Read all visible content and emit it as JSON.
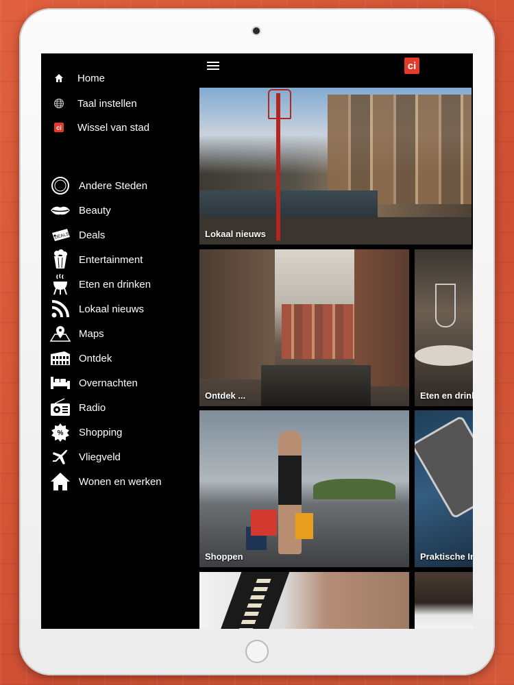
{
  "sidebar": {
    "top_items": [
      {
        "label": "Home",
        "icon": "home-icon"
      },
      {
        "label": "Taal instellen",
        "icon": "globe-icon"
      },
      {
        "label": "Wissel van stad",
        "icon": "ci-icon"
      }
    ],
    "items": [
      {
        "label": "Andere Steden",
        "icon": "compass-icon"
      },
      {
        "label": "Beauty",
        "icon": "lips-icon"
      },
      {
        "label": "Deals",
        "icon": "deals-tag-icon"
      },
      {
        "label": "Entertainment",
        "icon": "popcorn-icon"
      },
      {
        "label": "Eten en drinken",
        "icon": "grill-icon"
      },
      {
        "label": "Lokaal nieuws",
        "icon": "rss-icon"
      },
      {
        "label": "Maps",
        "icon": "map-pin-icon"
      },
      {
        "label": "Ontdek",
        "icon": "colosseum-icon"
      },
      {
        "label": "Overnachten",
        "icon": "bed-icon"
      },
      {
        "label": "Radio",
        "icon": "radio-icon"
      },
      {
        "label": "Shopping",
        "icon": "percent-badge-icon"
      },
      {
        "label": "Vliegveld",
        "icon": "airplane-icon"
      },
      {
        "label": "Wonen en werken",
        "icon": "house-icon"
      }
    ],
    "deals_badge": "DEALS"
  },
  "header": {
    "logo_text": "ci",
    "logo_color": "#e23a2b"
  },
  "tiles": [
    {
      "label": "Lokaal nieuws"
    },
    {
      "label": "Ontdek ..."
    },
    {
      "label": "Eten en drink"
    },
    {
      "label": "Shoppen"
    },
    {
      "label": "Praktische In"
    }
  ],
  "colors": {
    "background": "#d9573a",
    "screen": "#000000",
    "text": "#ffffff"
  }
}
